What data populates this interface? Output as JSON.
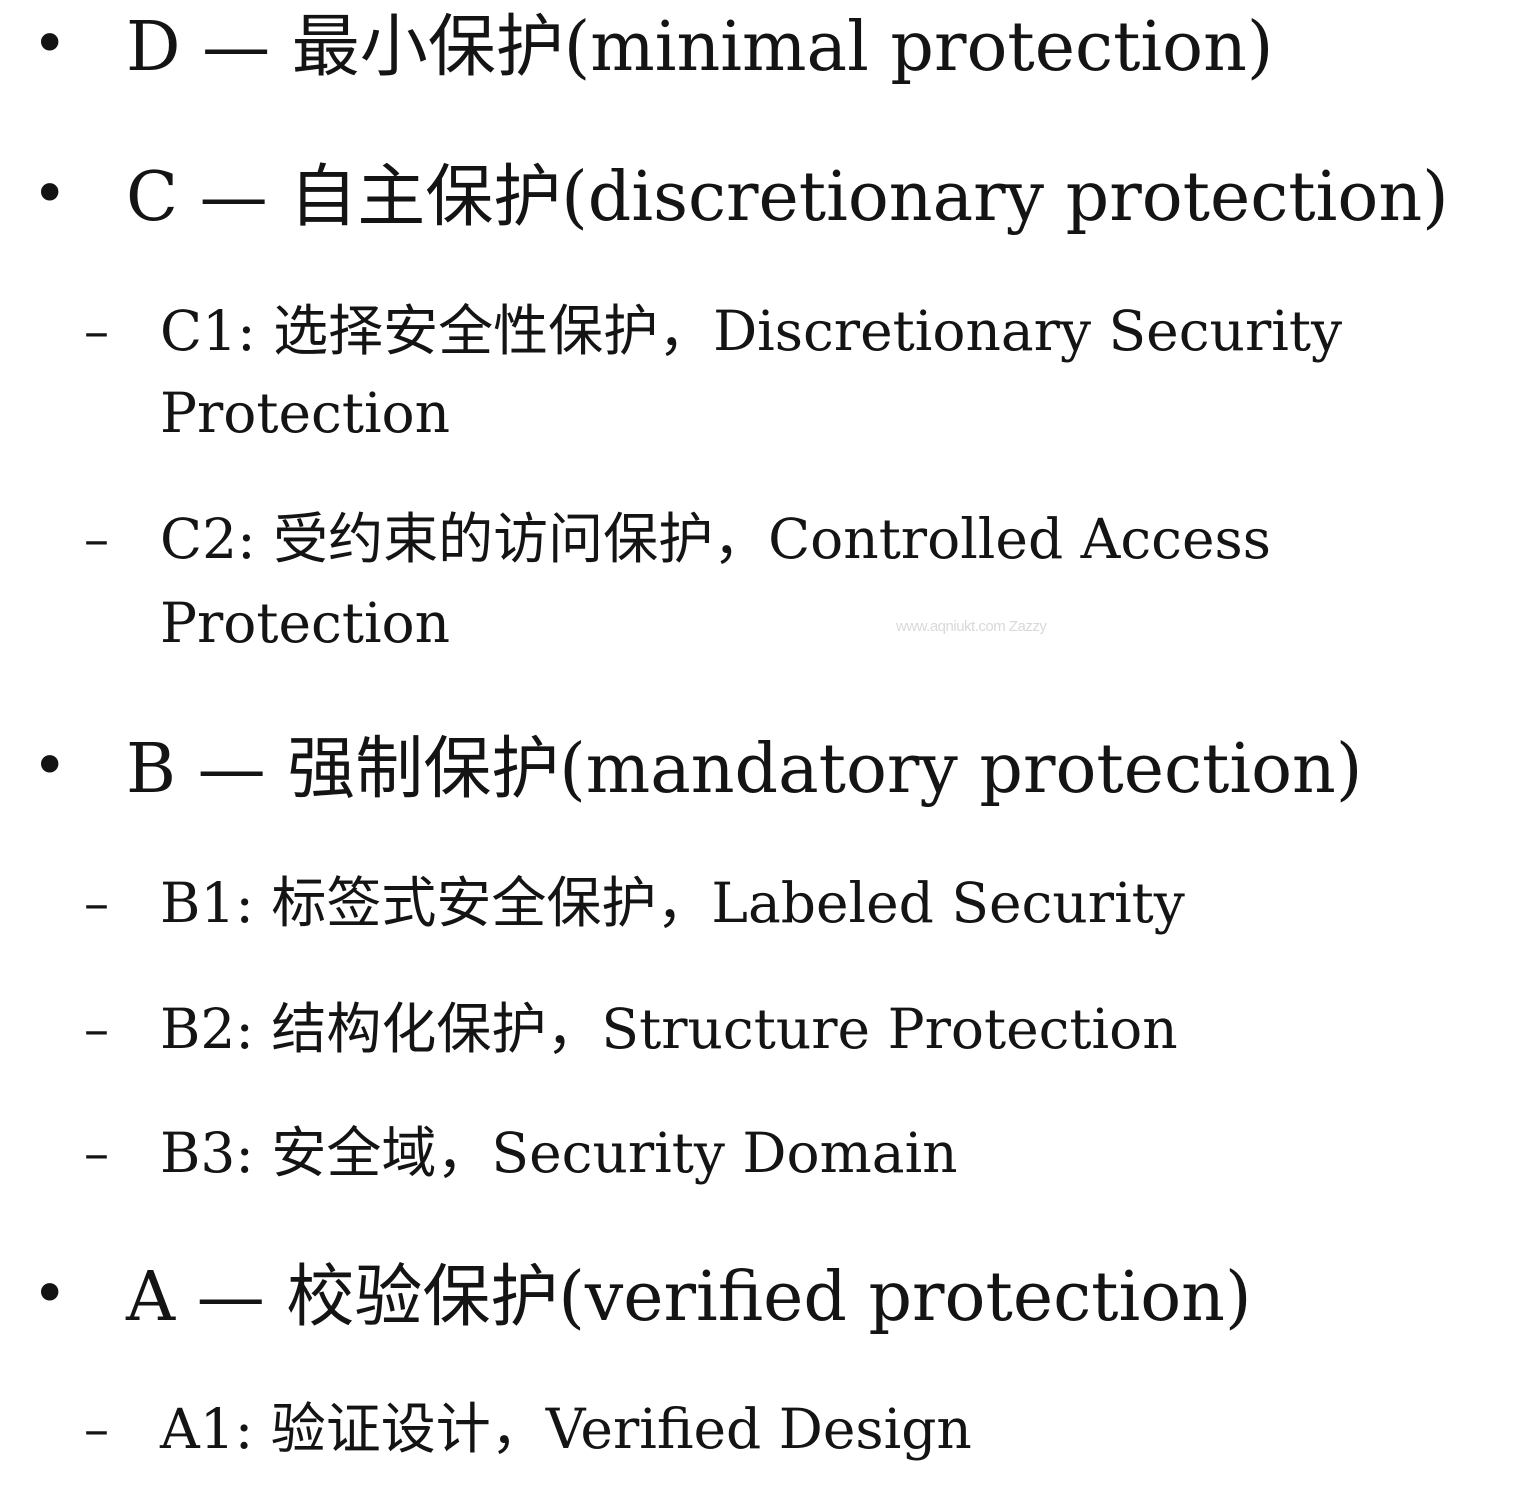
{
  "items": [
    {
      "marker": "•",
      "text": "D — 最小保护(minimal protection)",
      "subitems": []
    },
    {
      "marker": "•",
      "text": "C — 自主保护(discretionary protection)",
      "subitems": [
        {
          "marker": "–",
          "line1": "C1: 选择安全性保护，Discretionary Security",
          "line2": "Protection"
        },
        {
          "marker": "–",
          "line1": "C2: 受约束的访问保护，Controlled Access",
          "line2": "Protection"
        }
      ]
    },
    {
      "marker": "•",
      "text": "B — 强制保护(mandatory protection)",
      "subitems": [
        {
          "marker": "–",
          "line1": "B1: 标签式安全保护，Labeled Security"
        },
        {
          "marker": "–",
          "line1": "B2: 结构化保护，Structure Protection"
        },
        {
          "marker": "–",
          "line1": "B3: 安全域，Security Domain"
        }
      ]
    },
    {
      "marker": "•",
      "text": "A — 校验保护(verified protection)",
      "subitems": [
        {
          "marker": "–",
          "line1": "A1: 验证设计，Verified Design"
        }
      ]
    }
  ],
  "watermark": "www.aqniukt.com Zazzy"
}
